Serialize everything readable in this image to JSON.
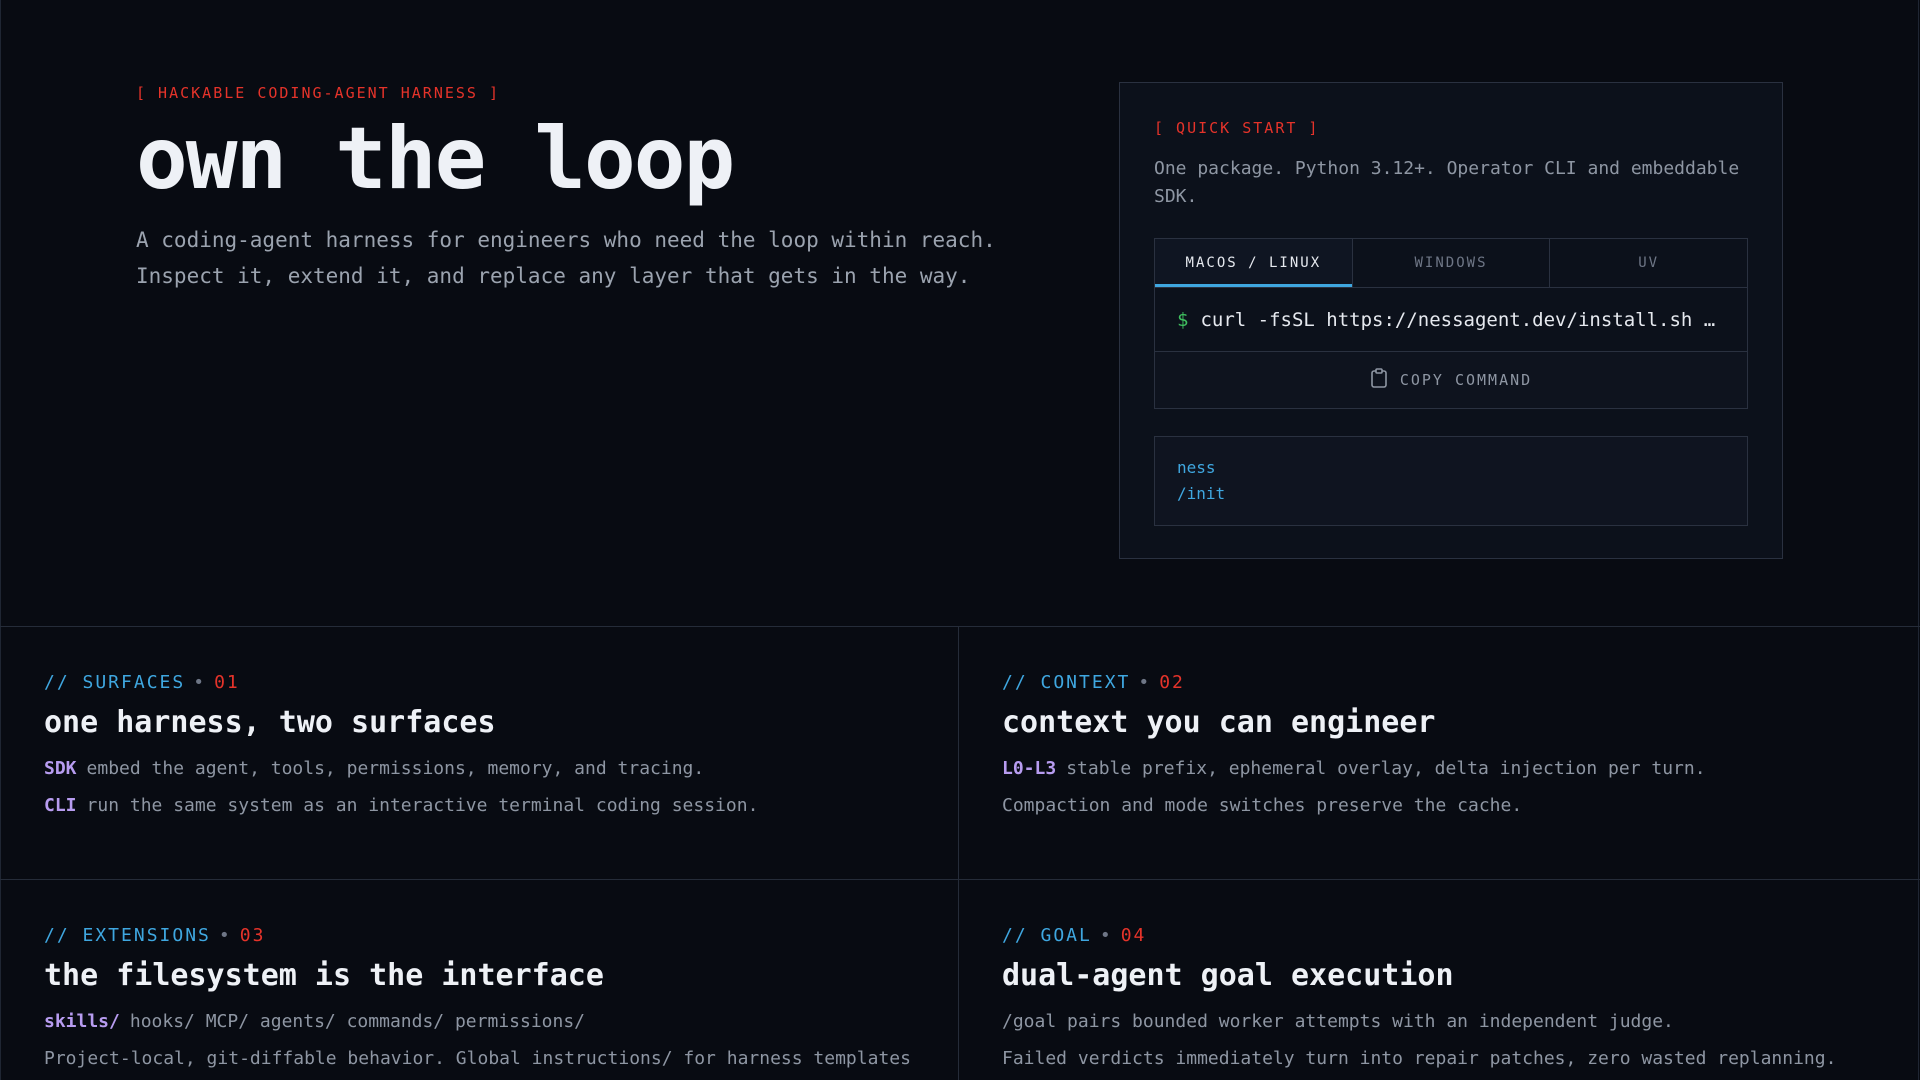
{
  "hero": {
    "tag": "[ HACKABLE CODING-AGENT HARNESS ]",
    "title": "own the loop",
    "desc_line1": "A coding-agent harness for engineers who need the loop within reach.",
    "desc_line2": "Inspect it, extend it, and replace any layer that gets in the way."
  },
  "quickstart": {
    "tag": "[ QUICK START ]",
    "desc": "One package. Python 3.12+. Operator CLI and embeddable SDK.",
    "tabs": [
      {
        "label": "MACOS / LINUX",
        "active": true
      },
      {
        "label": "WINDOWS",
        "active": false
      },
      {
        "label": "UV",
        "active": false
      }
    ],
    "prompt": "$",
    "command": "curl -fsSL https://nessagent.dev/install.sh …",
    "copy_label": "COPY COMMAND",
    "code_line1": "ness",
    "code_line2": "/init"
  },
  "features": [
    {
      "kicker": "// SURFACES",
      "num": "01",
      "title": "one harness, two surfaces",
      "lines": [
        {
          "key": "SDK",
          "text": "embed the agent, tools, permissions, memory, and tracing."
        },
        {
          "key": "CLI",
          "text": "run the same system as an interactive terminal coding session."
        }
      ]
    },
    {
      "kicker": "// CONTEXT",
      "num": "02",
      "title": "context you can engineer",
      "lines": [
        {
          "key": "L0-L3",
          "text": "stable prefix, ephemeral overlay, delta injection per turn."
        },
        {
          "key": "",
          "text": "Compaction and mode switches preserve the cache."
        }
      ]
    },
    {
      "kicker": "// EXTENSIONS",
      "num": "03",
      "title": "the filesystem is the interface",
      "lines": [
        {
          "key": "skills/",
          "text": "hooks/ MCP/ agents/ commands/ permissions/"
        },
        {
          "key": "",
          "text": "Project-local, git-diffable behavior. Global instructions/ for harness templates"
        }
      ]
    },
    {
      "kicker": "// GOAL",
      "num": "04",
      "title": "dual-agent goal execution",
      "lines": [
        {
          "key": "",
          "text": "/goal pairs bounded worker attempts with an independent judge."
        },
        {
          "key": "",
          "text": "Failed verdicts immediately turn into repair patches, zero wasted replanning."
        }
      ]
    }
  ],
  "colors": {
    "background": "#080b12",
    "accent_red": "#e5332a",
    "accent_blue": "#3fa7e0",
    "accent_purple": "#b79cf0",
    "prompt_green": "#3fbf5f"
  },
  "icons": {
    "copy": "clipboard-icon"
  }
}
